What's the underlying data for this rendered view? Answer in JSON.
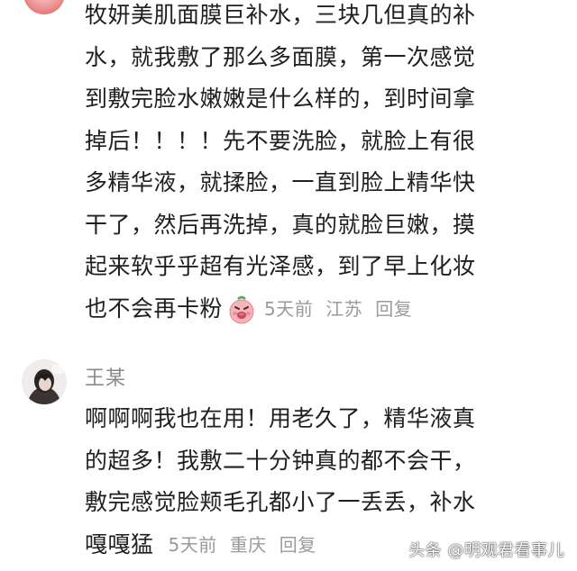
{
  "comment1": {
    "lines": [
      "牧妍美肌面膜巨补水，三块几但真的补",
      "水，就我敷了那么多面膜，第一次感觉",
      "到敷完脸水嫩嫩是什么样的，到时间拿",
      "掉后！！！！先不要洗脸，就脸上有很",
      "多精华液，就揉脸，一直到脸上精华快",
      "干了，然后再洗掉，真的就脸巨嫩，摸",
      "起来软乎乎超有光泽感，到了早上化妆",
      "也不会再卡粉"
    ],
    "emoji": "pig-face-emoji",
    "time": "5天前",
    "location": "江苏",
    "reply_label": "回复"
  },
  "comment2": {
    "username": "王某",
    "lines": [
      "啊啊啊我也在用！用老久了，精华液真",
      "的超多！我敷二十分钟真的都不会干，",
      "敷完感觉脸颊毛孔都小了一丢丢，补水",
      "嘎嘎猛"
    ],
    "time": "5天前",
    "location": "重庆",
    "reply_label": "回复"
  },
  "watermark": "头条 @明观君看事儿",
  "colors": {
    "text": "#1f1f1f",
    "meta": "#9a9a9a",
    "username": "#8a8a8a",
    "background": "#ffffff"
  }
}
